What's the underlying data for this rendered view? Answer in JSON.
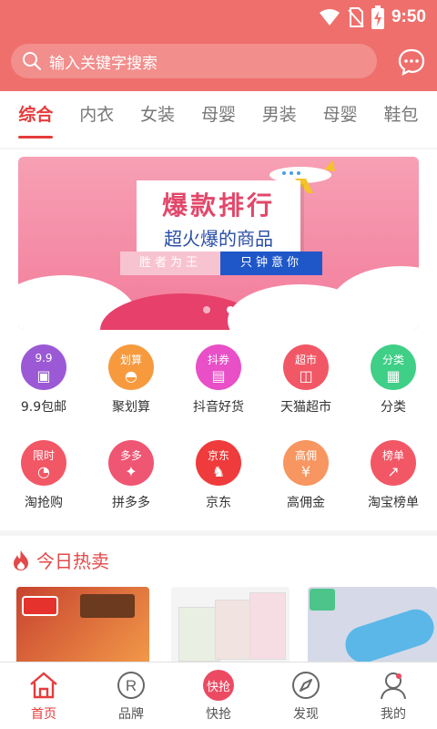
{
  "status": {
    "time": "9:50"
  },
  "search": {
    "placeholder": "输入关键字搜索"
  },
  "tabs": [
    {
      "label": "综合",
      "active": true
    },
    {
      "label": "内衣"
    },
    {
      "label": "女装"
    },
    {
      "label": "母婴"
    },
    {
      "label": "男装"
    },
    {
      "label": "母婴"
    },
    {
      "label": "鞋包"
    }
  ],
  "banner": {
    "title": "爆款排行",
    "subtitle": "超火爆的商品",
    "ribbon_left": "胜者为王",
    "ribbon_right": "只钟意你"
  },
  "categories": [
    {
      "label": "9.9包邮",
      "icon_text": "9.9",
      "icon": "box-icon",
      "color": "#9b59d6"
    },
    {
      "label": "聚划算",
      "icon_text": "划算",
      "icon": "shopping-bag-icon",
      "color": "#f79a3e"
    },
    {
      "label": "抖音好货",
      "icon_text": "抖券",
      "icon": "coupon-icon",
      "color": "#e94fc7"
    },
    {
      "label": "天猫超市",
      "icon_text": "超市",
      "icon": "basket-icon",
      "color": "#f25766"
    },
    {
      "label": "分类",
      "icon_text": "分类",
      "icon": "grid-icon",
      "color": "#3fcf86"
    },
    {
      "label": "淘抢购",
      "icon_text": "限时",
      "icon": "clock-bag-icon",
      "color": "#f25766"
    },
    {
      "label": "拼多多",
      "icon_text": "多多",
      "icon": "gift-icon",
      "color": "#ef5673"
    },
    {
      "label": "京东",
      "icon_text": "京东",
      "icon": "dog-icon",
      "color": "#ef3b3b"
    },
    {
      "label": "高佣金",
      "icon_text": "高佣",
      "icon": "money-bag-icon",
      "color": "#f79660"
    },
    {
      "label": "淘宝榜单",
      "icon_text": "榜单",
      "icon": "chart-up-icon",
      "color": "#f25766"
    }
  ],
  "hot": {
    "title": "今日热卖"
  },
  "nav": [
    {
      "label": "首页",
      "icon": "home-icon",
      "active": true
    },
    {
      "label": "品牌",
      "icon": "registered-icon"
    },
    {
      "label": "快抢",
      "icon": "flash-sale-icon"
    },
    {
      "label": "发现",
      "icon": "compass-icon"
    },
    {
      "label": "我的",
      "icon": "user-icon"
    }
  ],
  "colors": {
    "header": "#ef6f6c",
    "accent": "#e63b3b"
  }
}
